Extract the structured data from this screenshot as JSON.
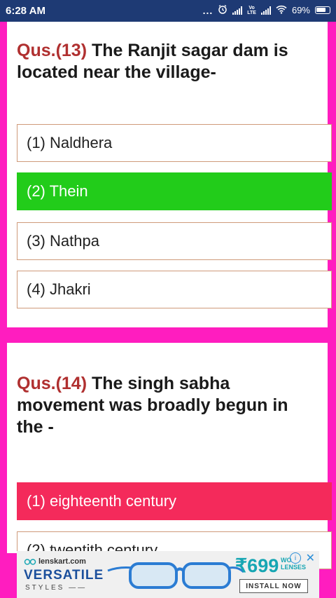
{
  "status_bar": {
    "time": "6:28 AM",
    "battery": "69%",
    "dots": "...",
    "volte": "Vo\nLTE"
  },
  "questions": [
    {
      "number": "Qus.(13)",
      "text": "The Ranjit sagar dam is located near the village-",
      "options": [
        {
          "label": "(1) Naldhera",
          "state": "normal"
        },
        {
          "label": "(2) Thein",
          "state": "correct"
        },
        {
          "label": "(3) Nathpa",
          "state": "normal"
        },
        {
          "label": "(4) Jhakri",
          "state": "normal"
        }
      ]
    },
    {
      "number": "Qus.(14)",
      "text": "The singh sabha movement was broadly begun in the -",
      "options": [
        {
          "label": "(1) eighteenth century",
          "state": "wrong"
        },
        {
          "label": "(2) twentith century",
          "state": "normal"
        }
      ]
    }
  ],
  "ad": {
    "brand": "lenskart.com",
    "headline": "VERSATILE",
    "subline": "STYLES",
    "price": "₹699",
    "price_unit_1": "WO",
    "price_unit_2": "LENSES",
    "cta": "INSTALL NOW",
    "adchoices_icon": "i",
    "close_icon": "✕"
  },
  "colors": {
    "status_bar": "#1e3a74",
    "page_border": "#ff1dbf",
    "correct": "#22cc1a",
    "wrong": "#f42a5b",
    "question_number": "#b03030"
  }
}
